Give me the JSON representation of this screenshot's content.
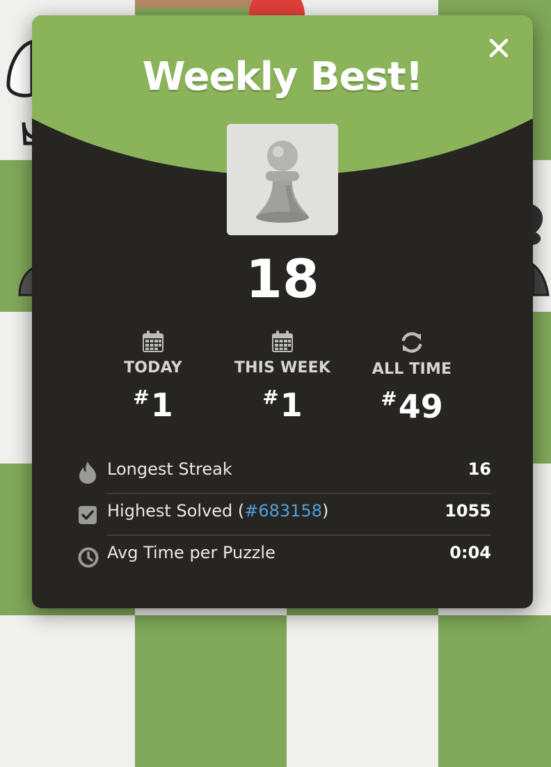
{
  "modal": {
    "title": "Weekly Best!",
    "score": "18",
    "piece_icon": "pawn-icon",
    "close_icon": "close-icon",
    "ranks": [
      {
        "label": "TODAY",
        "hash": "#",
        "value": "1",
        "icon": "calendar-icon"
      },
      {
        "label": "THIS WEEK",
        "hash": "#",
        "value": "1",
        "icon": "calendar-icon"
      },
      {
        "label": "ALL TIME",
        "hash": "#",
        "value": "49",
        "icon": "refresh-icon"
      }
    ],
    "stats": [
      {
        "label": "Longest Streak",
        "value": "16",
        "icon": "flame-icon"
      },
      {
        "label_prefix": "Highest Solved (",
        "link": "#683158",
        "label_suffix": ")",
        "value": "1055",
        "icon": "checkbox-icon"
      },
      {
        "label": "Avg Time per Puzzle",
        "value": "0:04",
        "icon": "clock-icon"
      }
    ]
  },
  "colors": {
    "header_green": "#8bb45a",
    "modal_bg": "#262522",
    "link_blue": "#4f9fe0",
    "board_green": "#81a85a",
    "board_light": "#f0f0ee"
  }
}
